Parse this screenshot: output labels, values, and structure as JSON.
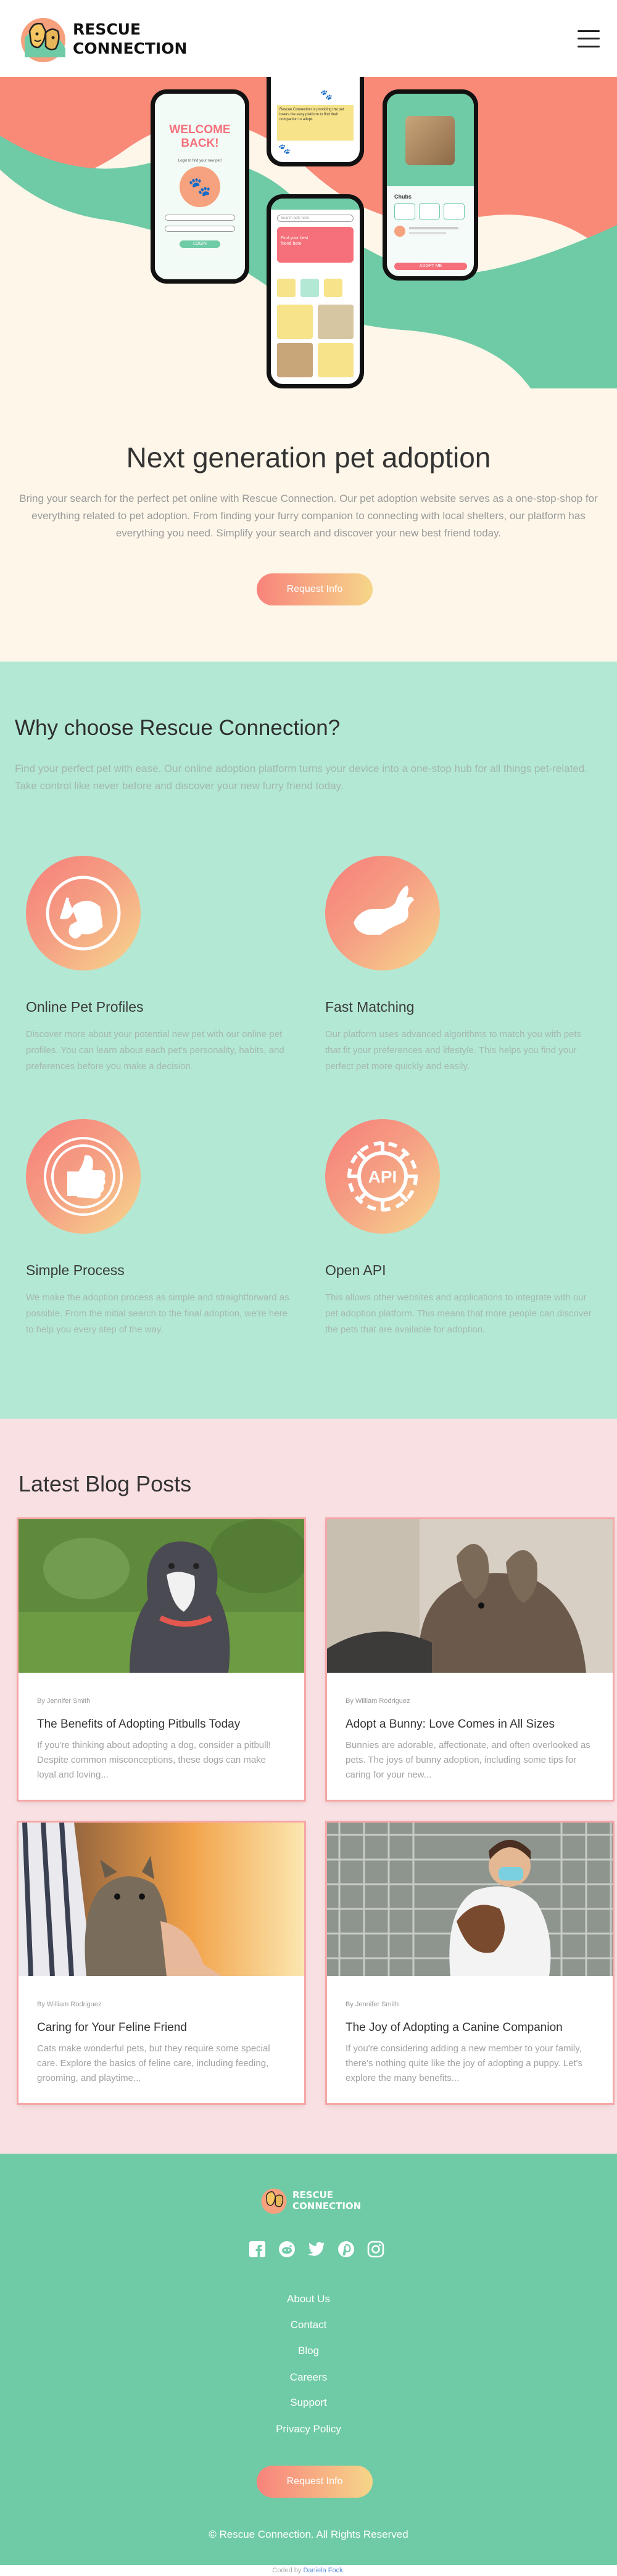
{
  "header": {
    "logo_line1": "RESCUE",
    "logo_line2": "CONNECTION"
  },
  "hero": {
    "title": "Next generation pet adoption",
    "description": "Bring your search for the perfect pet online with Rescue Connection. Our pet adoption website serves as a one-stop-shop for everything related to pet adoption. From finding your furry companion to connecting with local shelters, our platform has everything you need. Simplify your search and discover your new best friend today.",
    "cta": "Request Info",
    "mockup": {
      "welcome_title": "WELCOME BACK!",
      "welcome_sub": "Login to find your new pet!",
      "login_button": "LOGIN",
      "pet_name": "Chubs",
      "adopt_button": "ADOPT ME",
      "search_placeholder": "Search pets here",
      "banner_text": "Find your best friend here",
      "about_text": "Rescue Connection is providing the pet lovers the easy platform to find their companion to adopt."
    }
  },
  "why": {
    "title": "Why choose Rescue Connection?",
    "intro": "Find your perfect pet with ease. Our online adoption platform turns your device into a one-stop hub for all things pet-related. Take control like never before and discover your new furry friend today.",
    "features": [
      {
        "icon": "dog-cat-icon",
        "title": "Online Pet Profiles",
        "text": "Discover more about your potential new pet with our online pet profiles. You can learn about each pet's personality, habits, and preferences before you make a decision."
      },
      {
        "icon": "rabbit-icon",
        "title": "Fast Matching",
        "text": "Our platform uses advanced algorithms to match you with pets that fit your preferences and lifestyle. This helps you find your perfect pet more quickly and easily."
      },
      {
        "icon": "thumbs-up-icon",
        "title": "Simple Process",
        "text": "We make the adoption process as simple and straightforward as possible. From the initial search to the final adoption, we're here to help you every step of the way."
      },
      {
        "icon": "api-gear-icon",
        "title": "Open API",
        "icon_text": "API",
        "text": "This allows other websites and applications to integrate with our pet adoption platform. This means that more people can discover the pets that are available for adoption."
      }
    ]
  },
  "blog": {
    "title": "Latest Blog Posts",
    "posts": [
      {
        "author": "By Jennifer Smith",
        "title": "The Benefits of Adopting Pitbulls Today",
        "excerpt": "If you're thinking about adopting a dog, consider a pitbull! Despite common misconceptions, these dogs can make loyal and loving..."
      },
      {
        "author": "By William Rodriguez",
        "title": "Adopt a Bunny: Love Comes in All Sizes",
        "excerpt": "Bunnies are adorable, affectionate, and often overlooked as pets. The joys of bunny adoption, including some tips for caring for your new..."
      },
      {
        "author": "By William Rodriguez",
        "title": "Caring for Your Feline Friend",
        "excerpt": "Cats make wonderful pets, but they require some special care. Explore the basics of feline care, including feeding, grooming, and playtime..."
      },
      {
        "author": "By Jennifer Smith",
        "title": "The Joy of Adopting a Canine Companion",
        "excerpt": "If you're considering adding a new member to your family, there's nothing quite like the joy of adopting a puppy. Let's explore the many benefits..."
      }
    ]
  },
  "footer": {
    "logo_line1": "RESCUE",
    "logo_line2": "CONNECTION",
    "social": [
      "facebook-icon",
      "reddit-icon",
      "twitter-icon",
      "pinterest-icon",
      "instagram-icon"
    ],
    "links": [
      "About Us",
      "Contact",
      "Blog",
      "Careers",
      "Support",
      "Privacy Policy"
    ],
    "cta": "Request Info",
    "copyright": "© Rescue Connection. All Rights Reserved"
  },
  "credit": {
    "prefix": "Coded by",
    "name": "Daniela Fock."
  },
  "colors": {
    "mint": "#6fcba6",
    "light_mint": "#b3e8d5",
    "cream": "#fdf6e9",
    "pink": "#f9e0e3",
    "coral": "#f8837c",
    "gold": "#f6d689"
  }
}
